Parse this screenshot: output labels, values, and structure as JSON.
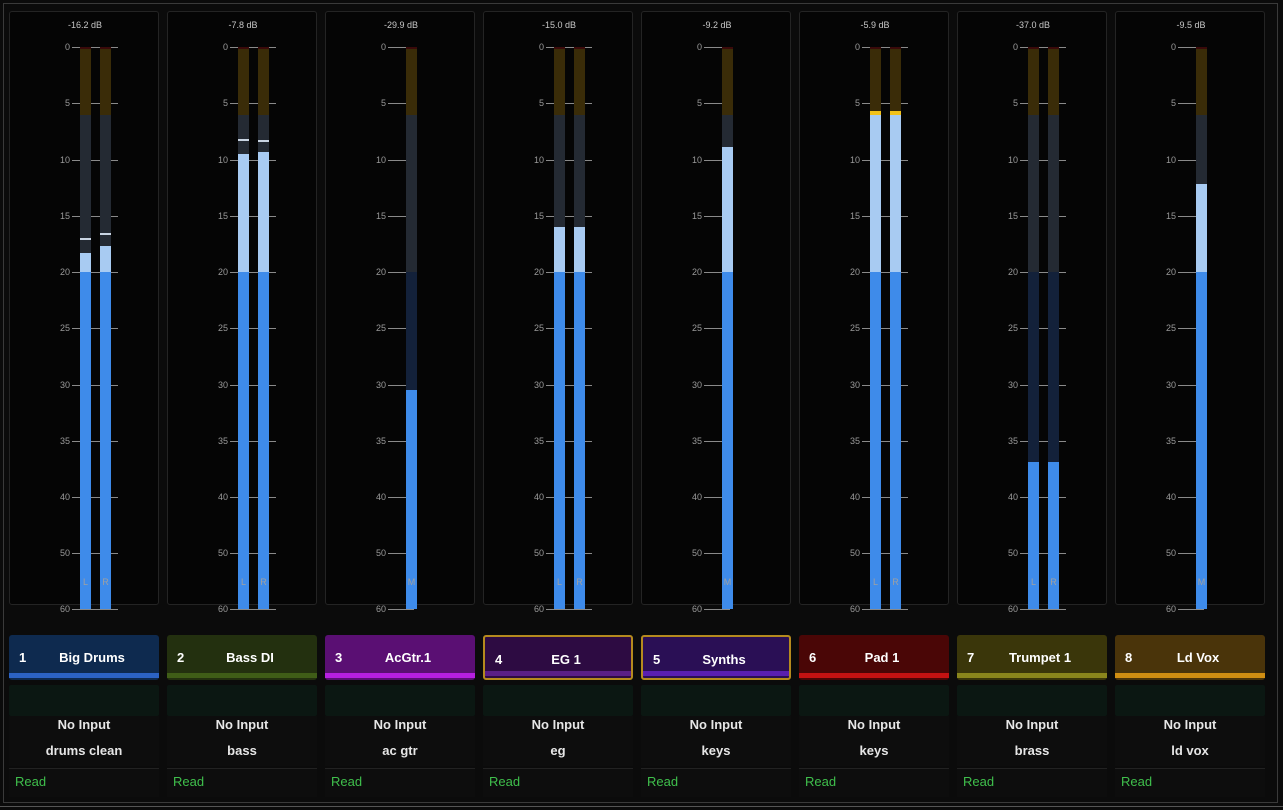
{
  "mixer": {
    "scale_marks": [
      "0",
      "5",
      "10",
      "15",
      "20",
      "25",
      "30",
      "35",
      "40",
      "50",
      "60"
    ],
    "channel_labels": {
      "left": "L",
      "right": "R",
      "mono": "M"
    },
    "meter_colors": {
      "signal": "#3e8bea",
      "signal_upper": "#a8cbf2",
      "hot": "#f2c21a",
      "track_upper": "#242a33",
      "track_lower": "#13213a",
      "track_caution": "#3a2c08",
      "track_clip": "#3a0a0a"
    },
    "strips": [
      {
        "number": "1",
        "name": "Big Drums",
        "peak": "-16.2 dB",
        "color": "#0e2a4f",
        "stripe": "#2c63c4",
        "stereo": true,
        "levels": [
          18.3,
          17.7
        ],
        "holds": [
          17.0,
          16.5
        ],
        "selected": false,
        "input": "No Input",
        "output": "drums clean",
        "automation": "Read"
      },
      {
        "number": "2",
        "name": "Bass DI",
        "peak": "-7.8 dB",
        "color": "#23300f",
        "stripe": "#3f5d17",
        "stereo": true,
        "levels": [
          9.5,
          9.3
        ],
        "holds": [
          8.2,
          8.3
        ],
        "selected": false,
        "input": "No Input",
        "output": "bass",
        "automation": "Read"
      },
      {
        "number": "3",
        "name": "AcGtr.1",
        "peak": "-29.9 dB",
        "color": "#5a0f73",
        "stripe": "#b61fe0",
        "stereo": false,
        "levels": [
          30.5
        ],
        "holds": [],
        "selected": false,
        "input": "No Input",
        "output": "ac gtr",
        "automation": "Read"
      },
      {
        "number": "4",
        "name": "EG 1",
        "peak": "-15.0 dB",
        "color": "#2d0b42",
        "stripe": "#5a1f86",
        "stereo": true,
        "levels": [
          16.0,
          16.0
        ],
        "holds": [],
        "selected": true,
        "input": "No Input",
        "output": "eg",
        "automation": "Read"
      },
      {
        "number": "5",
        "name": "Synths",
        "peak": "-9.2 dB",
        "color": "#2a0f55",
        "stripe": "#5a1fb0",
        "stereo": false,
        "levels": [
          8.9
        ],
        "holds": [],
        "selected": true,
        "input": "No Input",
        "output": "keys",
        "automation": "Read"
      },
      {
        "number": "6",
        "name": "Pad 1",
        "peak": "-5.9 dB",
        "color": "#4a0606",
        "stripe": "#c41212",
        "stereo": true,
        "levels": [
          6.0,
          6.0
        ],
        "holds": [],
        "hot": true,
        "selected": false,
        "input": "No Input",
        "output": "keys",
        "automation": "Read"
      },
      {
        "number": "7",
        "name": "Trumpet 1",
        "peak": "-37.0 dB",
        "color": "#3a360a",
        "stripe": "#8a861c",
        "stereo": true,
        "levels": [
          36.9,
          36.9
        ],
        "holds": [],
        "selected": false,
        "input": "No Input",
        "output": "brass",
        "automation": "Read"
      },
      {
        "number": "8",
        "name": "Ld Vox",
        "peak": "-9.5 dB",
        "color": "#4a340a",
        "stripe": "#d08e12",
        "stereo": false,
        "levels": [
          12.2
        ],
        "holds": [],
        "selected": false,
        "input": "No Input",
        "output": "ld vox",
        "automation": "Read"
      }
    ]
  }
}
